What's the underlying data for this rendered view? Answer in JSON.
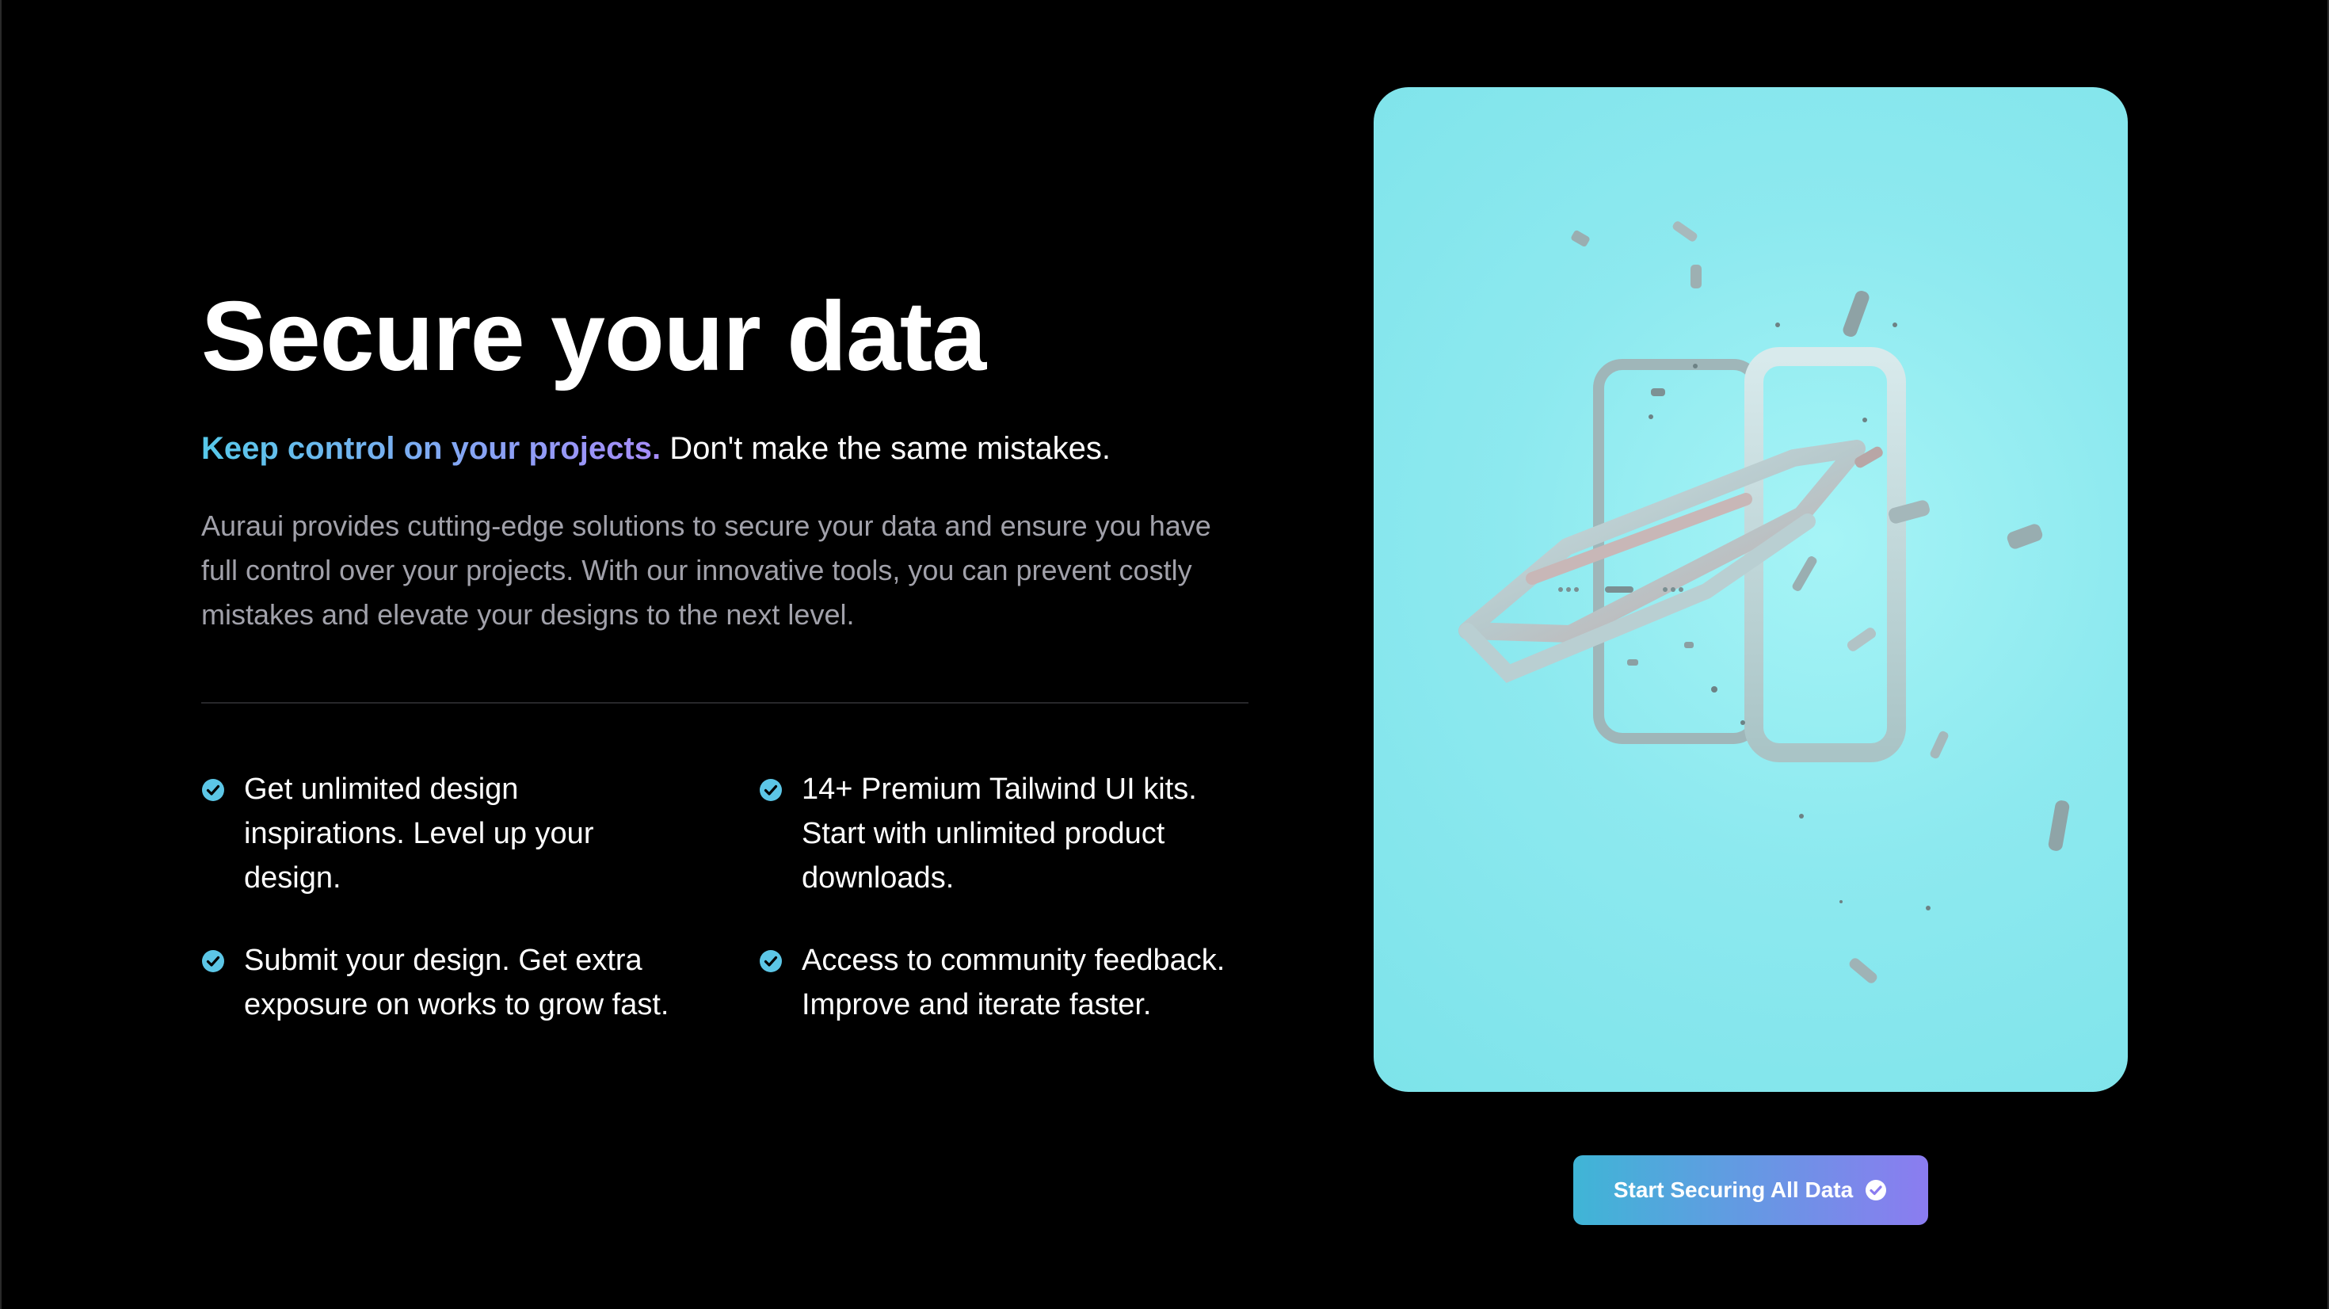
{
  "hero": {
    "title": "Secure your data",
    "tagline_accent": "Keep control on your projects.",
    "tagline_rest": " Don't make the same mistakes.",
    "description": "Auraui provides cutting-edge solutions to secure your data and ensure you have full control over your projects. With our innovative tools, you can prevent costly mistakes and elevate your designs to the next level."
  },
  "features": [
    {
      "text": "Get unlimited design inspirations. Level up your design.",
      "icon": "check-circle-icon"
    },
    {
      "text": "14+ Premium Tailwind UI kits. Start with unlimited product downloads.",
      "icon": "check-circle-icon"
    },
    {
      "text": "Submit your design. Get extra exposure on works to grow fast.",
      "icon": "check-circle-icon"
    },
    {
      "text": "Access to community feedback. Improve and iterate faster.",
      "icon": "check-circle-icon"
    }
  ],
  "visual": {
    "image": "phone-frames-illustration",
    "background": "#8ee9ef"
  },
  "cta": {
    "label": "Start Securing All Data",
    "icon": "check-circle-icon"
  },
  "colors": {
    "background": "#000000",
    "accent_start": "#56c9ea",
    "accent_end": "#a78bfa",
    "check_icon": "#5cc6e6",
    "muted_text": "#a1a1aa"
  }
}
